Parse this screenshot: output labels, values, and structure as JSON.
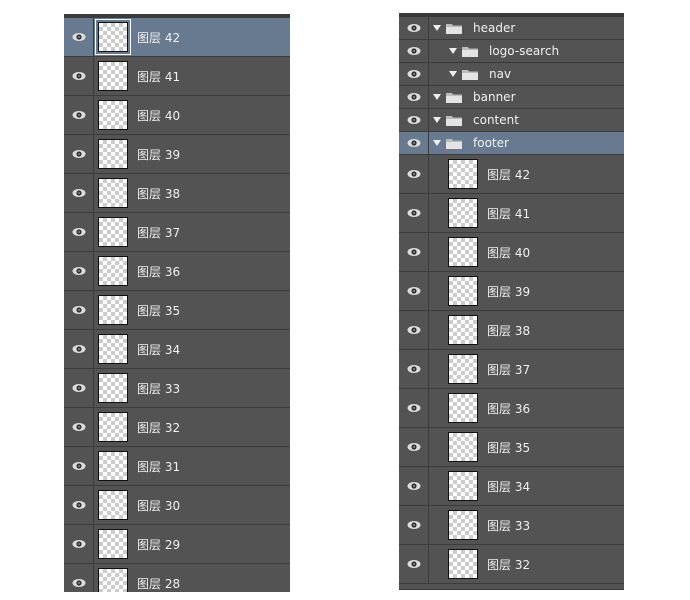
{
  "left_panel": {
    "layers": [
      {
        "name": "图层 42",
        "selected": true
      },
      {
        "name": "图层 41"
      },
      {
        "name": "图层 40"
      },
      {
        "name": "图层 39"
      },
      {
        "name": "图层 38"
      },
      {
        "name": "图层 37"
      },
      {
        "name": "图层 36"
      },
      {
        "name": "图层 35"
      },
      {
        "name": "图层 34"
      },
      {
        "name": "图层 33"
      },
      {
        "name": "图层 32"
      },
      {
        "name": "图层 31"
      },
      {
        "name": "图层 30"
      },
      {
        "name": "图层 29"
      },
      {
        "name": "图层 28"
      }
    ]
  },
  "right_panel": {
    "groups": [
      {
        "name": "header",
        "level": 0,
        "expanded": true
      },
      {
        "name": "logo-search",
        "level": 1,
        "expanded": true
      },
      {
        "name": "nav",
        "level": 1,
        "expanded": true
      },
      {
        "name": "banner",
        "level": 0,
        "expanded": true
      },
      {
        "name": "content",
        "level": 0,
        "expanded": true
      },
      {
        "name": "footer",
        "level": 0,
        "expanded": true,
        "selected": true
      }
    ],
    "layers": [
      {
        "name": "图层 42"
      },
      {
        "name": "图层 41"
      },
      {
        "name": "图层 40"
      },
      {
        "name": "图层 39"
      },
      {
        "name": "图层 38"
      },
      {
        "name": "图层 37"
      },
      {
        "name": "图层 36"
      },
      {
        "name": "图层 35"
      },
      {
        "name": "图层 34"
      },
      {
        "name": "图层 33"
      },
      {
        "name": "图层 32"
      }
    ]
  },
  "colors": {
    "panel": "#535353",
    "selected": "#687a90",
    "border": "#3b3b3b"
  }
}
